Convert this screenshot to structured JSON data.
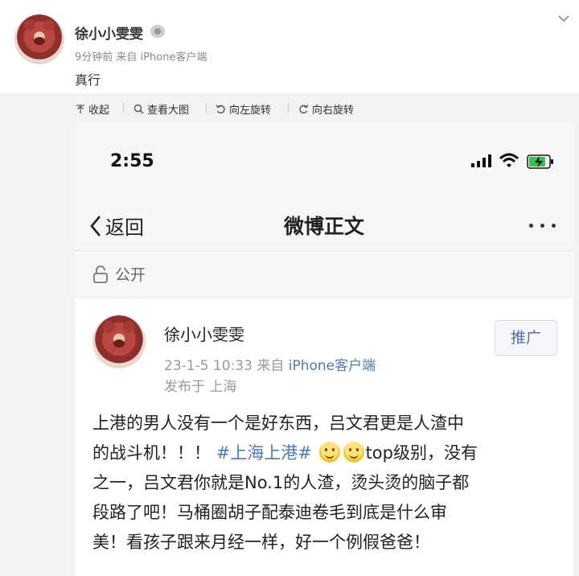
{
  "post": {
    "author": "徐小小雯雯",
    "time": "9分钟前",
    "source_prefix": "来自",
    "source": "iPhone客户端",
    "text": "真行"
  },
  "toolbar": {
    "collapse": "收起",
    "view_large": "查看大图",
    "rotate_left": "向左旋转",
    "rotate_right": "向右旋转"
  },
  "phone": {
    "status_time": "2:55",
    "nav": {
      "back": "返回",
      "title": "微博正文"
    },
    "visibility": "公开",
    "card": {
      "author": "徐小小雯雯",
      "date": "23-1-5 10:33",
      "source_prefix": "来自",
      "source": "iPhone客户端",
      "location": "发布于 上海",
      "promote": "推广",
      "text": {
        "l1": "上港的男人没有一个是好东西，吕文君更是人渣中",
        "l2_a": "的战斗机！！！",
        "l2_topic": "#上海上港#",
        "l2_b": "top级别，没有",
        "l3": "之一，吕文君你就是No.1的人渣，烫头烫的脑子都",
        "l4": "段路了吧！马桶圈胡子配泰迪卷毛到底是什么审",
        "l5": "美！看孩子跟来月经一样，好一个例假爸爸！"
      }
    }
  },
  "icons": {
    "collapse": "collapse-arrow-icon",
    "search": "search-icon",
    "rotate_left": "rotate-left-icon",
    "rotate_right": "rotate-right-icon"
  },
  "colors": {
    "link": "#4e7ab7",
    "toolbar_bg": "#f2f2f2"
  }
}
